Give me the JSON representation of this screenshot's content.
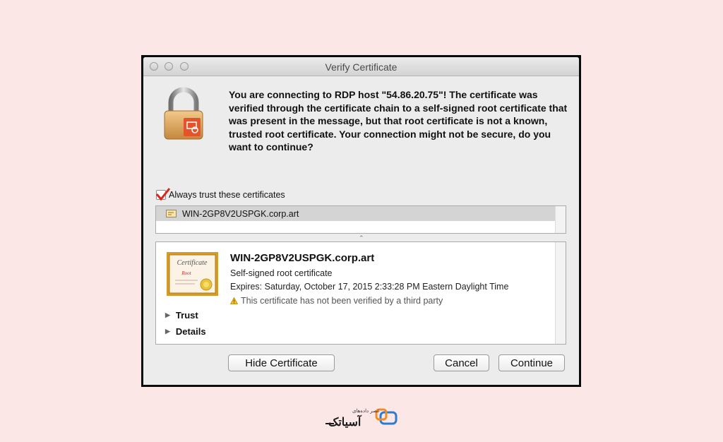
{
  "window": {
    "title": "Verify Certificate",
    "message": "You are connecting to RDP host \"54.86.20.75\"! The certificate was verified through the certificate chain to a self-signed root certificate that was present in the message, but that root certificate is not a known, trusted root certificate. Your connection might not be secure, do you want to continue?"
  },
  "trust_checkbox": {
    "label": "Always trust these certificates",
    "checked": true,
    "check_color": "#d9261c"
  },
  "certificate_list": {
    "items": [
      {
        "name": "WIN-2GP8V2USPGK.corp.art"
      }
    ]
  },
  "certificate_detail": {
    "image_text_top": "Certificate",
    "image_text_mid": "Root",
    "name": "WIN-2GP8V2USPGK.corp.art",
    "type": "Self-signed root certificate",
    "expires": "Expires: Saturday, October 17, 2015 2:33:28 PM Eastern Daylight Time",
    "warning": "This certificate has not been verified by a third party",
    "sections": [
      "Trust",
      "Details"
    ]
  },
  "buttons": {
    "hide_certificate": "Hide Certificate",
    "cancel": "Cancel",
    "continue": "Continue"
  },
  "watermark": {
    "brand": "آسیاتک",
    "tagline": "عصر داده‌های",
    "colors": {
      "blue": "#2a7bd1",
      "orange": "#f28c28"
    }
  }
}
